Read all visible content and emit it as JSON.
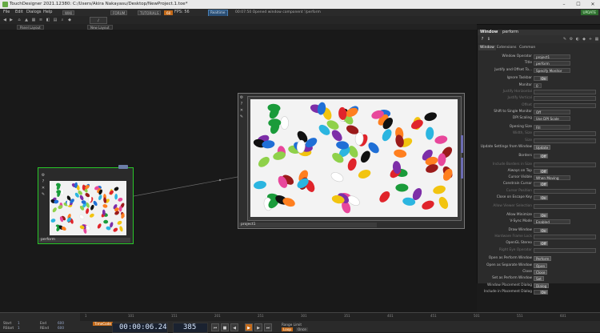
{
  "window": {
    "title": "TouchDesigner 2021.12380: C:/Users/Akira Nakayasu/Desktop/NewProject.1.toe*",
    "min": "–",
    "max": "☐",
    "close": "✕"
  },
  "menubar": {
    "items": [
      "File",
      "Edit",
      "Dialogs",
      "Help"
    ],
    "wiki": "WIKI",
    "forum": "FORUM",
    "tutorials": "TUTORIALS",
    "fps_badge": "60",
    "fps_label": "FPS: 56",
    "realtime": "Realtime",
    "status": "00:07:50 Opened window component '/perform",
    "update": "UPDATE"
  },
  "toolbar": {
    "path": "/",
    "panel_layout": "Panel Layout",
    "new_layout": "New Layout"
  },
  "nodes": {
    "perform": {
      "label": "perform"
    },
    "project1": {
      "label": "project1"
    }
  },
  "panel": {
    "header_type": "Window",
    "header_name": "perform",
    "tabs": [
      "Window",
      "Extensions",
      "Common"
    ],
    "params": [
      {
        "label": "Window Operator",
        "value": "project1",
        "kind": "field"
      },
      {
        "label": "Title",
        "value": "perform",
        "kind": "field"
      },
      {
        "label": "Justify and Offset To...",
        "value": "Specify Monitor",
        "kind": "field"
      },
      {
        "label": "Ignore Taskbar",
        "value": "On",
        "kind": "toggle"
      },
      {
        "label": "Monitor",
        "value": "0",
        "kind": "field"
      },
      {
        "label": "Justify Horizontal",
        "value": "",
        "kind": "dim"
      },
      {
        "label": "Justify Vertical",
        "value": "",
        "kind": "dim"
      },
      {
        "label": "Offset",
        "value": "",
        "kind": "dim"
      },
      {
        "label": "Shift to Single Monitor",
        "value": "Off",
        "kind": "field"
      },
      {
        "label": "DPI Scaling",
        "value": "Use DPI Scale",
        "kind": "field"
      },
      {
        "label": "Opening Size",
        "value": "Fill",
        "kind": "field"
      },
      {
        "label": "Width, Size",
        "value": "",
        "kind": "dim"
      },
      {
        "label": "Size",
        "value": "",
        "kind": "dim"
      },
      {
        "label": "Update Settings from Window",
        "value": "Update",
        "kind": "button"
      },
      {
        "label": "Borders",
        "value": "Off",
        "kind": "toggle"
      },
      {
        "label": "Include Borders in Size",
        "value": "",
        "kind": "dim"
      },
      {
        "label": "Always on Top",
        "value": "Off",
        "kind": "toggle"
      },
      {
        "label": "Cursor Visible",
        "value": "When Moving",
        "kind": "field"
      },
      {
        "label": "Constrain Cursor",
        "value": "Off",
        "kind": "toggle"
      },
      {
        "label": "Cursor Position",
        "value": "",
        "kind": "dim"
      },
      {
        "label": "Close on Escape Key",
        "value": "On",
        "kind": "toggle"
      },
      {
        "label": "Allow Viewer Selection",
        "value": "",
        "kind": "dim"
      },
      {
        "label": "Allow Minimize",
        "value": "On",
        "kind": "toggle"
      },
      {
        "label": "V-Sync Mode",
        "value": "Enabled",
        "kind": "field"
      },
      {
        "label": "Draw Window",
        "value": "On",
        "kind": "toggle"
      },
      {
        "label": "Hardware Frame Lock",
        "value": "",
        "kind": "dim"
      },
      {
        "label": "OpenGL Stereo",
        "value": "Off",
        "kind": "toggle"
      },
      {
        "label": "Right Eye Operator",
        "value": "",
        "kind": "dim"
      },
      {
        "label": "Open as Perform Window",
        "value": "Perform",
        "kind": "button"
      },
      {
        "label": "Open as Separate Window",
        "value": "Open",
        "kind": "button"
      },
      {
        "label": "Close",
        "value": "Close",
        "kind": "button"
      },
      {
        "label": "Set as Perform Window",
        "value": "Set",
        "kind": "button"
      },
      {
        "label": "Window Placement Dialog",
        "value": "Dialog",
        "kind": "button"
      },
      {
        "label": "Include in Placement Dialog",
        "value": "On",
        "kind": "toggle"
      }
    ]
  },
  "timeline": {
    "start_label": "Start",
    "start_val": "1",
    "end_label": "End",
    "end_val": "600",
    "rstart_label": "RStart",
    "rstart_val": "1",
    "rend_label": "REnd",
    "rend_val": "600",
    "timecode_label": "TimeCode",
    "timecode": "00:00:06.24",
    "frame": "385",
    "range_label": "Range Limit",
    "range_loop": "Loop",
    "range_once": "Once",
    "ruler_ticks": [
      "1",
      "101",
      "151",
      "201",
      "251",
      "301",
      "351",
      "401",
      "451",
      "501",
      "551",
      "601"
    ]
  },
  "colors": {
    "node_selected": "#29c829",
    "accent_orange": "#c36a1a",
    "realtime_blue": "#2b4f75"
  }
}
